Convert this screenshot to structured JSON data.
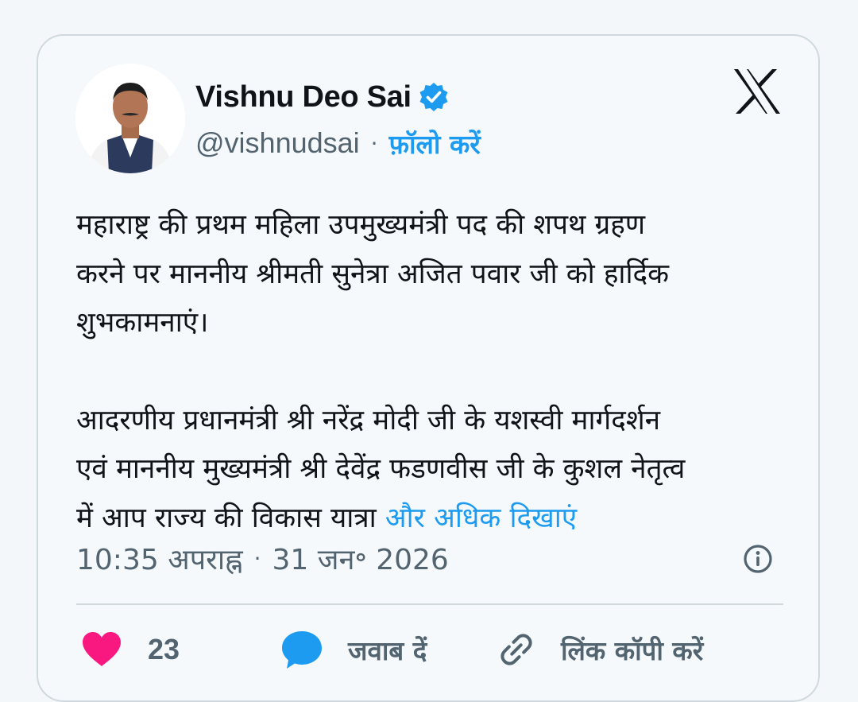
{
  "author": {
    "name": "Vishnu Deo Sai",
    "handle": "@vishnudsai",
    "follow_label": "फ़ॉलो करें",
    "verified_color": "#1d9bf0"
  },
  "tweet": {
    "paragraph1": "महाराष्ट्र की प्रथम महिला उपमुख्यमंत्री पद की शपथ ग्रहण\nकरने पर माननीय श्रीमती सुनेत्रा अजित पवार जी को हार्दिक\nशुभकामनाएं।",
    "paragraph2": "आदरणीय प्रधानमंत्री श्री नरेंद्र मोदी जी के यशस्वी मार्गदर्शन\nएवं माननीय मुख्यमंत्री श्री देवेंद्र फडणवीस जी के कुशल नेतृत्व\nमें आप राज्य की विकास यात्रा ",
    "show_more": "और अधिक दिखाएं"
  },
  "meta": {
    "time": "10:35 अपराह्न",
    "date": "31 जन॰ 2026"
  },
  "actions": {
    "like_count": "23",
    "reply_label": "जवाब दें",
    "copy_link_label": "लिंक कॉपी करें"
  },
  "colors": {
    "like": "#f91880",
    "reply": "#1d9bf0",
    "link": "#1d9bf0",
    "text": "#0f1419",
    "muted": "#536471"
  },
  "icons": [
    "verified-badge-icon",
    "x-logo-icon",
    "info-icon",
    "heart-icon",
    "reply-bubble-icon",
    "link-icon"
  ]
}
